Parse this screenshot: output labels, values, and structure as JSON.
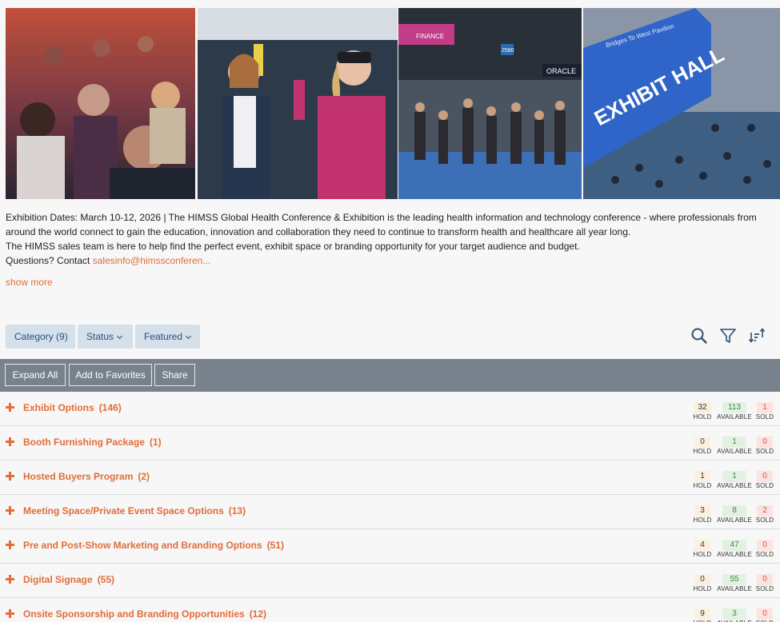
{
  "description": {
    "line1": "Exhibition Dates: March 10-12, 2026 | The HIMSS Global Health Conference & Exhibition is the leading health information and technology conference - where professionals from",
    "line2": "around the world connect to gain the education, innovation and collaboration they need to continue to transform health and healthcare all year long.",
    "line3": "The HIMSS sales team is here to help find the perfect event, exhibit space or branding opportunity for your target audience and budget.",
    "line4_prefix": "Questions? Contact ",
    "email_link": "salesinfo@himssconferen...",
    "show_more": "show more"
  },
  "photos": {
    "exhibit_hall_sign": "EXHIBIT HALL",
    "bridge_sign": "Bridges To West Pavilion",
    "booth_sign_1": "FINANCE",
    "booth_sign_2": "ORACLE",
    "booth_number": "2580"
  },
  "filters": {
    "category": "Category (9)",
    "status": "Status",
    "featured": "Featured"
  },
  "actions": {
    "expand_all": "Expand All",
    "add_to_favorites": "Add to Favorites",
    "share": "Share"
  },
  "labels": {
    "hold": "HOLD",
    "available": "AVAILABLE",
    "sold": "SOLD"
  },
  "colors": {
    "accent": "#e06d3a",
    "filter_bg": "#d4e0ea",
    "actionbar_bg": "#78828d"
  },
  "categories": [
    {
      "title": "Exhibit Options",
      "count": "(146)",
      "hold": "32",
      "available": "113",
      "sold": "1"
    },
    {
      "title": "Booth Furnishing Package",
      "count": "(1)",
      "hold": "0",
      "available": "1",
      "sold": "0"
    },
    {
      "title": "Hosted Buyers Program",
      "count": "(2)",
      "hold": "1",
      "available": "1",
      "sold": "0"
    },
    {
      "title": "Meeting Space/Private Event Space Options",
      "count": "(13)",
      "hold": "3",
      "available": "8",
      "sold": "2"
    },
    {
      "title": "Pre and Post-Show Marketing and Branding Options",
      "count": "(51)",
      "hold": "4",
      "available": "47",
      "sold": "0"
    },
    {
      "title": "Digital Signage",
      "count": "(55)",
      "hold": "0",
      "available": "55",
      "sold": "0"
    },
    {
      "title": "Onsite Sponsorship and Branding Opportunities",
      "count": "(12)",
      "hold": "9",
      "available": "3",
      "sold": "0"
    }
  ]
}
